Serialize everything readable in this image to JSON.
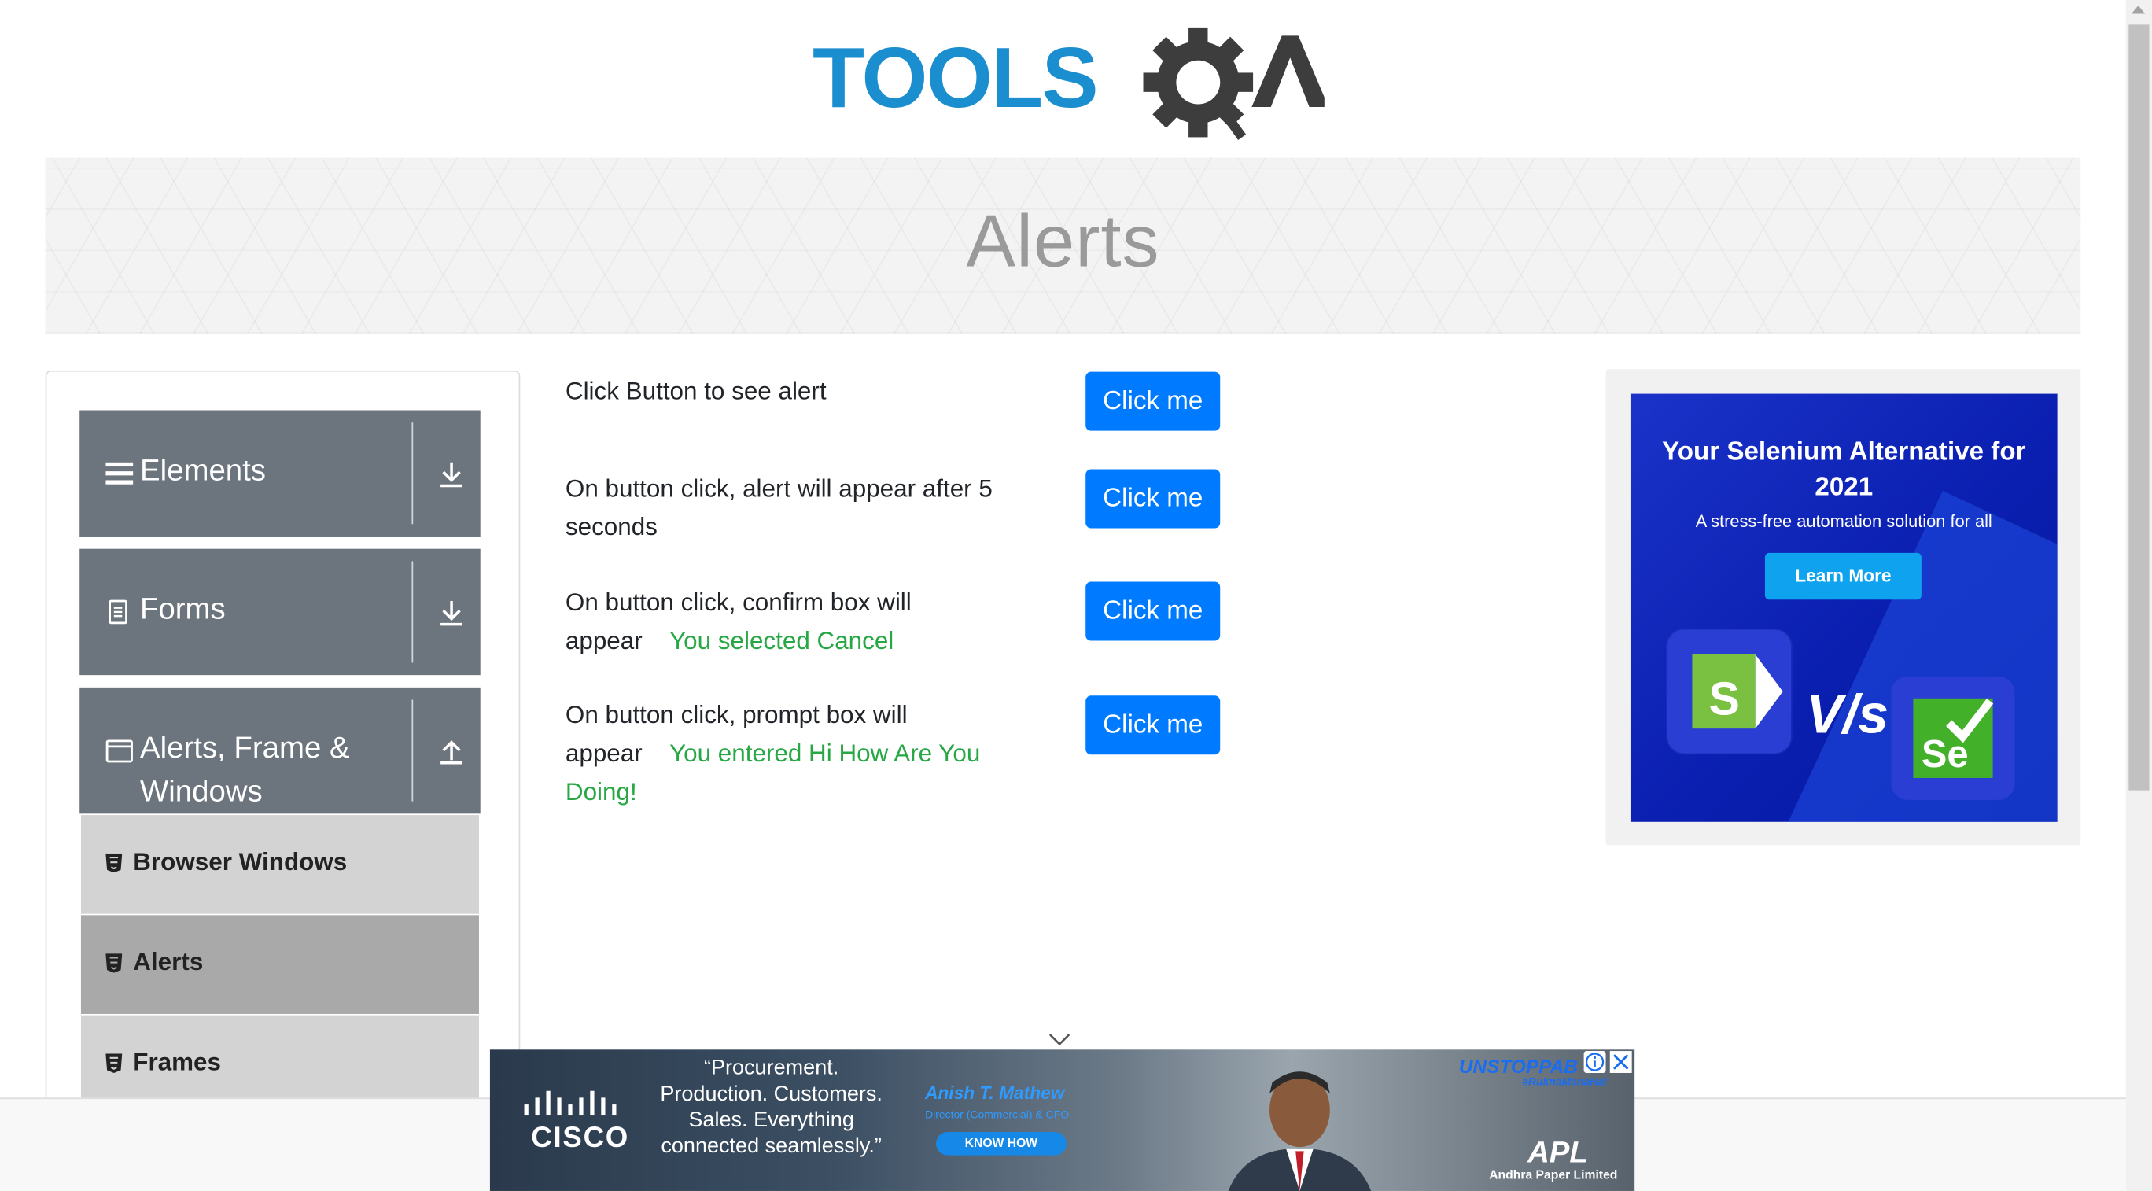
{
  "header": {
    "logo_text_left": "TOOLS",
    "logo_text_right": "QA",
    "logo_brand_color": "#1a8ece",
    "logo_dark_color": "#3d3d3d"
  },
  "banner": {
    "title": "Alerts"
  },
  "sidebar": {
    "groups": [
      {
        "label": "Elements",
        "icon": "hamburger-icon",
        "arrow": "download-arrow-icon"
      },
      {
        "label": "Forms",
        "icon": "document-icon",
        "arrow": "download-arrow-icon"
      },
      {
        "label": "Alerts, Frame & Windows",
        "icon": "window-icon",
        "arrow": "upload-arrow-icon"
      }
    ],
    "items": [
      {
        "label": "Browser Windows",
        "icon": "html5-icon"
      },
      {
        "label": "Alerts",
        "icon": "html5-icon",
        "active": true
      },
      {
        "label": "Frames",
        "icon": "html5-icon"
      }
    ],
    "group_color": "#6c757d",
    "item_color": "#d3d3d3",
    "active_item_color": "#a9a9a9"
  },
  "main": {
    "rows": [
      {
        "text": "Click Button to see alert",
        "result": "",
        "button": "Click me"
      },
      {
        "text": "On button click, alert will appear after 5 seconds",
        "result": "",
        "button": "Click me"
      },
      {
        "text": "On button click, confirm box will appear",
        "result": "You selected Cancel",
        "button": "Click me"
      },
      {
        "text": "On button click, prompt box will appear",
        "result": "You entered Hi How Are You Doing!",
        "button": "Click me"
      }
    ],
    "button_color": "#007bff",
    "result_color": "#28a745"
  },
  "side_ad": {
    "headline": "Your Selenium Alternative for 2021",
    "subline": "A stress-free automation solution for all",
    "button": "Learn More",
    "vs_text": "V/s",
    "logo_left": "S",
    "logo_right": "Se"
  },
  "bottom_ad": {
    "brand": "CISCO",
    "quote": "“Procurement. Production. Customers. Sales. Everything connected seamlessly.”",
    "person_name": "Anish T. Mathew",
    "person_title": "Director (Commercial) & CFO",
    "cta": "KNOW HOW",
    "campaign": "UNSTOPPAB",
    "hashtag": "#RuknaManaHai",
    "company": "Andhra Paper Limited",
    "company_mark": "APL"
  }
}
